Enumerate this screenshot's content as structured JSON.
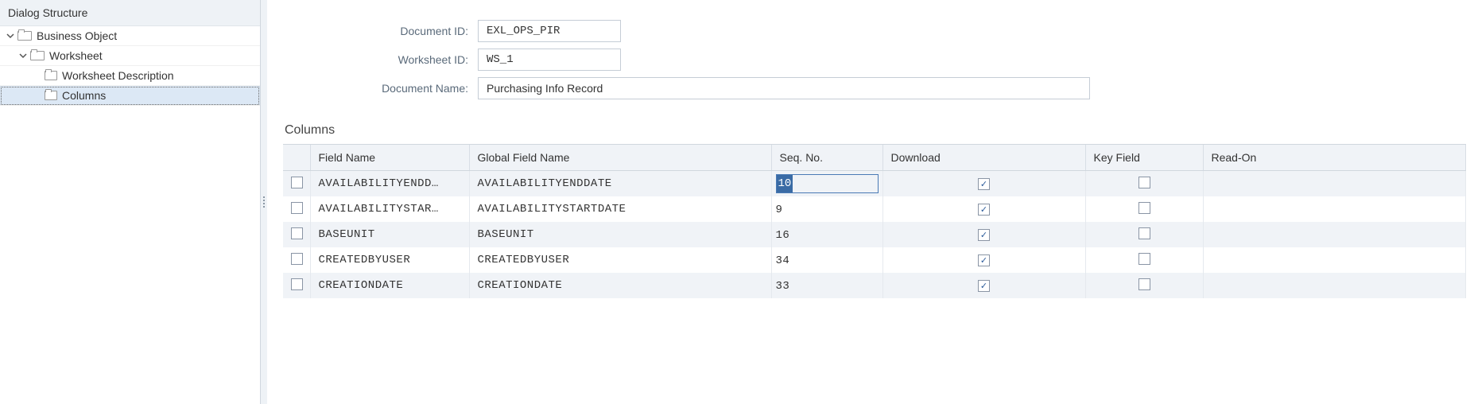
{
  "sidebar": {
    "title": "Dialog Structure",
    "items": [
      {
        "label": "Business Object",
        "level": 0,
        "expanded": true,
        "selected": false
      },
      {
        "label": "Worksheet",
        "level": 1,
        "expanded": true,
        "selected": false
      },
      {
        "label": "Worksheet Description",
        "level": 2,
        "expanded": null,
        "selected": false
      },
      {
        "label": "Columns",
        "level": 2,
        "expanded": null,
        "selected": true
      }
    ]
  },
  "form": {
    "document_id_label": "Document ID:",
    "document_id_value": "EXL_OPS_PIR",
    "worksheet_id_label": "Worksheet ID:",
    "worksheet_id_value": "WS_1",
    "document_name_label": "Document Name:",
    "document_name_value": "Purchasing Info Record"
  },
  "table": {
    "section_title": "Columns",
    "headers": {
      "field_name": "Field Name",
      "global_field_name": "Global Field Name",
      "seq_no": "Seq. No.",
      "download": "Download",
      "key_field": "Key Field",
      "read_on": "Read-On"
    },
    "rows": [
      {
        "field": "AVAILABILITYENDD…",
        "global": "AVAILABILITYENDDATE",
        "seq": "10",
        "download": true,
        "key": false,
        "active": true
      },
      {
        "field": "AVAILABILITYSTAR…",
        "global": "AVAILABILITYSTARTDATE",
        "seq": "9",
        "download": true,
        "key": false,
        "active": false
      },
      {
        "field": "BASEUNIT",
        "global": "BASEUNIT",
        "seq": "16",
        "download": true,
        "key": false,
        "active": false
      },
      {
        "field": "CREATEDBYUSER",
        "global": "CREATEDBYUSER",
        "seq": "34",
        "download": true,
        "key": false,
        "active": false
      },
      {
        "field": "CREATIONDATE",
        "global": "CREATIONDATE",
        "seq": "33",
        "download": true,
        "key": false,
        "active": false
      }
    ]
  }
}
